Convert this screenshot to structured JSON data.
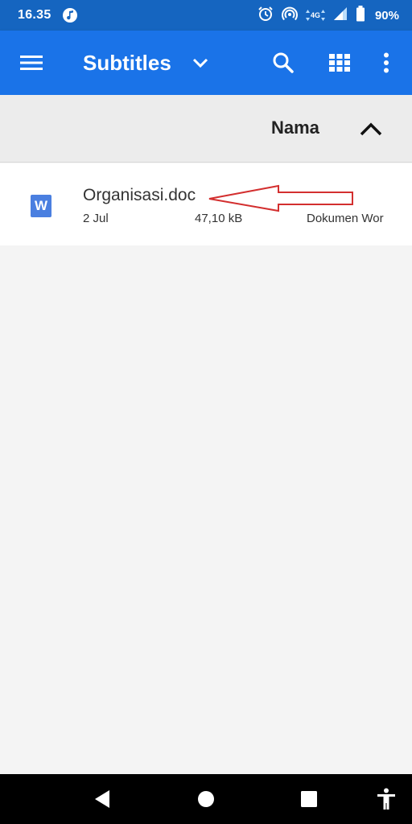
{
  "status_bar": {
    "time": "16.35",
    "network": "4G",
    "battery": "90%"
  },
  "app_bar": {
    "title": "Subtitles",
    "icons": {
      "menu": "hamburger-menu-icon",
      "dropdown": "chevron-down-icon",
      "search": "search-icon",
      "view": "grid-view-icon",
      "more": "more-vert-icon"
    }
  },
  "sort_header": {
    "label": "Nama",
    "direction": "ascending"
  },
  "files": [
    {
      "icon_letter": "W",
      "name": "Organisasi.doc",
      "date": "2 Jul",
      "size": "47,10 kB",
      "type": "Dokumen Wor"
    }
  ],
  "colors": {
    "status_bar": "#1565c0",
    "app_bar": "#1a73e8",
    "word_icon": "#4a7fe0",
    "annotation_arrow": "#d32f2f",
    "list_background": "#f4f4f4"
  }
}
